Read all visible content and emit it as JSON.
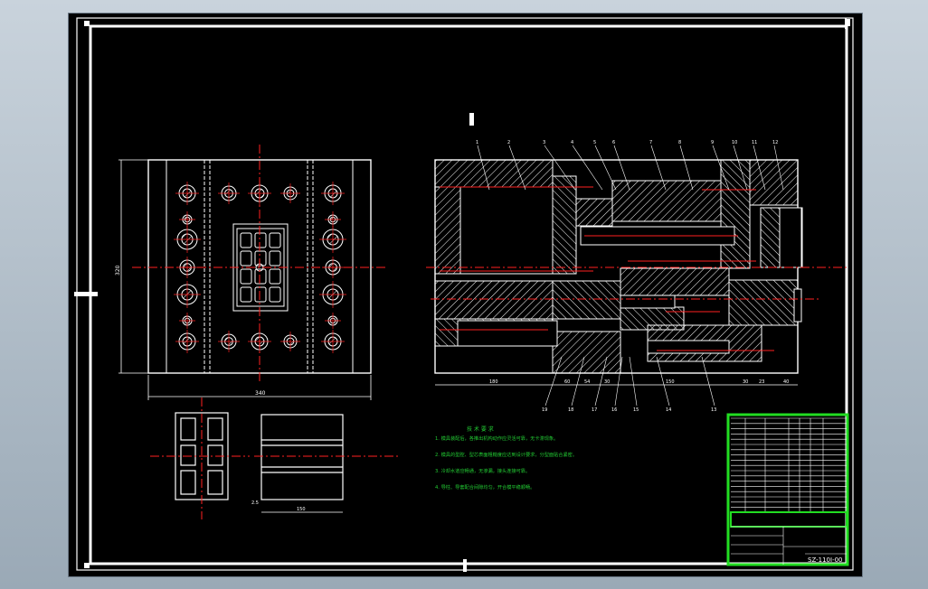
{
  "colors": {
    "background": "#000000",
    "frame": "#ffffff",
    "centerline": "#ff2020",
    "hatch": "#ffffff",
    "notes_text": "#22cc33",
    "title_block": "#22dd22",
    "dimension": "#ffffff"
  },
  "plan_view": {
    "dims": {
      "width": "340",
      "height": "320"
    }
  },
  "section_view": {
    "part_numbers_top": [
      "1",
      "2",
      "3",
      "4",
      "5",
      "6",
      "7",
      "8",
      "9",
      "10",
      "11",
      "12"
    ],
    "part_numbers_bottom": [
      "19",
      "18",
      "17",
      "16",
      "15",
      "14",
      "13"
    ],
    "dims_bottom": [
      "180",
      "60",
      "54",
      "30",
      "150",
      "30",
      "23",
      "40"
    ]
  },
  "small_part": {
    "dim": "150",
    "dim_left": "2.5"
  },
  "notes": {
    "title": "技 术 要 求",
    "paragraphs": [
      "1. 模具装配后，各推出机构动作应灵活可靠，无卡滞现象。",
      "2. 模具的型腔、型芯表面粗糙度应达到设计要求，分型面贴合紧密。",
      "3. 冷却水道应畅通，无渗漏，接头连接可靠。",
      "4. 导柱、导套配合间隙均匀，开合模平稳顺畅。"
    ]
  },
  "title_block": {
    "drawing_number": "SZ-110I-00",
    "bom_rows": 18
  }
}
